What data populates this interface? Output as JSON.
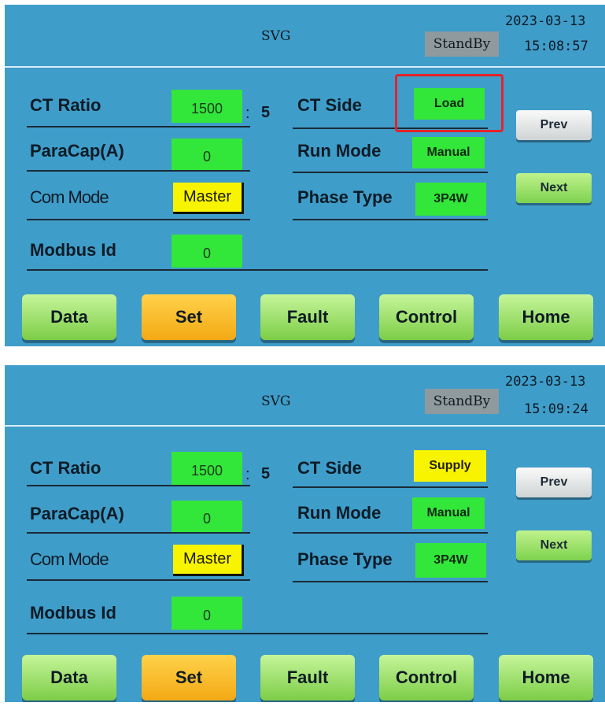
{
  "screens": [
    {
      "header": {
        "title": "SVG",
        "status": "StandBy",
        "date": "2023-03-13",
        "time": "15:08:57"
      },
      "fields": {
        "ct_ratio_label": "CT Ratio",
        "ct_ratio_value": "1500",
        "ct_ratio_colon": ":",
        "ct_ratio_secondary": "5",
        "paracap_label": "ParaCap(A)",
        "paracap_value": "0",
        "com_mode_label": "Com Mode",
        "com_mode_value": "Master",
        "modbus_id_label": "Modbus Id",
        "modbus_id_value": "0",
        "ct_side_label": "CT Side",
        "ct_side_value": "Load",
        "run_mode_label": "Run Mode",
        "run_mode_value": "Manual",
        "phase_type_label": "Phase Type",
        "phase_type_value": "3P4W"
      },
      "side_buttons": {
        "prev": "Prev",
        "next": "Next"
      },
      "nav": {
        "data": "Data",
        "set": "Set",
        "fault": "Fault",
        "control": "Control",
        "home": "Home"
      },
      "colors": {
        "ct_side_field": "#33e63a",
        "annotation": "#e5222a"
      }
    },
    {
      "header": {
        "title": "SVG",
        "status": "StandBy",
        "date": "2023-03-13",
        "time": "15:09:24"
      },
      "fields": {
        "ct_ratio_label": "CT Ratio",
        "ct_ratio_value": "1500",
        "ct_ratio_colon": ":",
        "ct_ratio_secondary": "5",
        "paracap_label": "ParaCap(A)",
        "paracap_value": "0",
        "com_mode_label": "Com Mode",
        "com_mode_value": "Master",
        "modbus_id_label": "Modbus Id",
        "modbus_id_value": "0",
        "ct_side_label": "CT Side",
        "ct_side_value": "Supply",
        "run_mode_label": "Run Mode",
        "run_mode_value": "Manual",
        "phase_type_label": "Phase Type",
        "phase_type_value": "3P4W"
      },
      "side_buttons": {
        "prev": "Prev",
        "next": "Next"
      },
      "nav": {
        "data": "Data",
        "set": "Set",
        "fault": "Fault",
        "control": "Control",
        "home": "Home"
      },
      "colors": {
        "ct_side_field": "#f8f400"
      }
    }
  ],
  "theme": {
    "panel": "#3f9dc9",
    "field_green": "#33e63a",
    "field_yellow": "#f8f400",
    "set_orange": "#f3a915"
  }
}
